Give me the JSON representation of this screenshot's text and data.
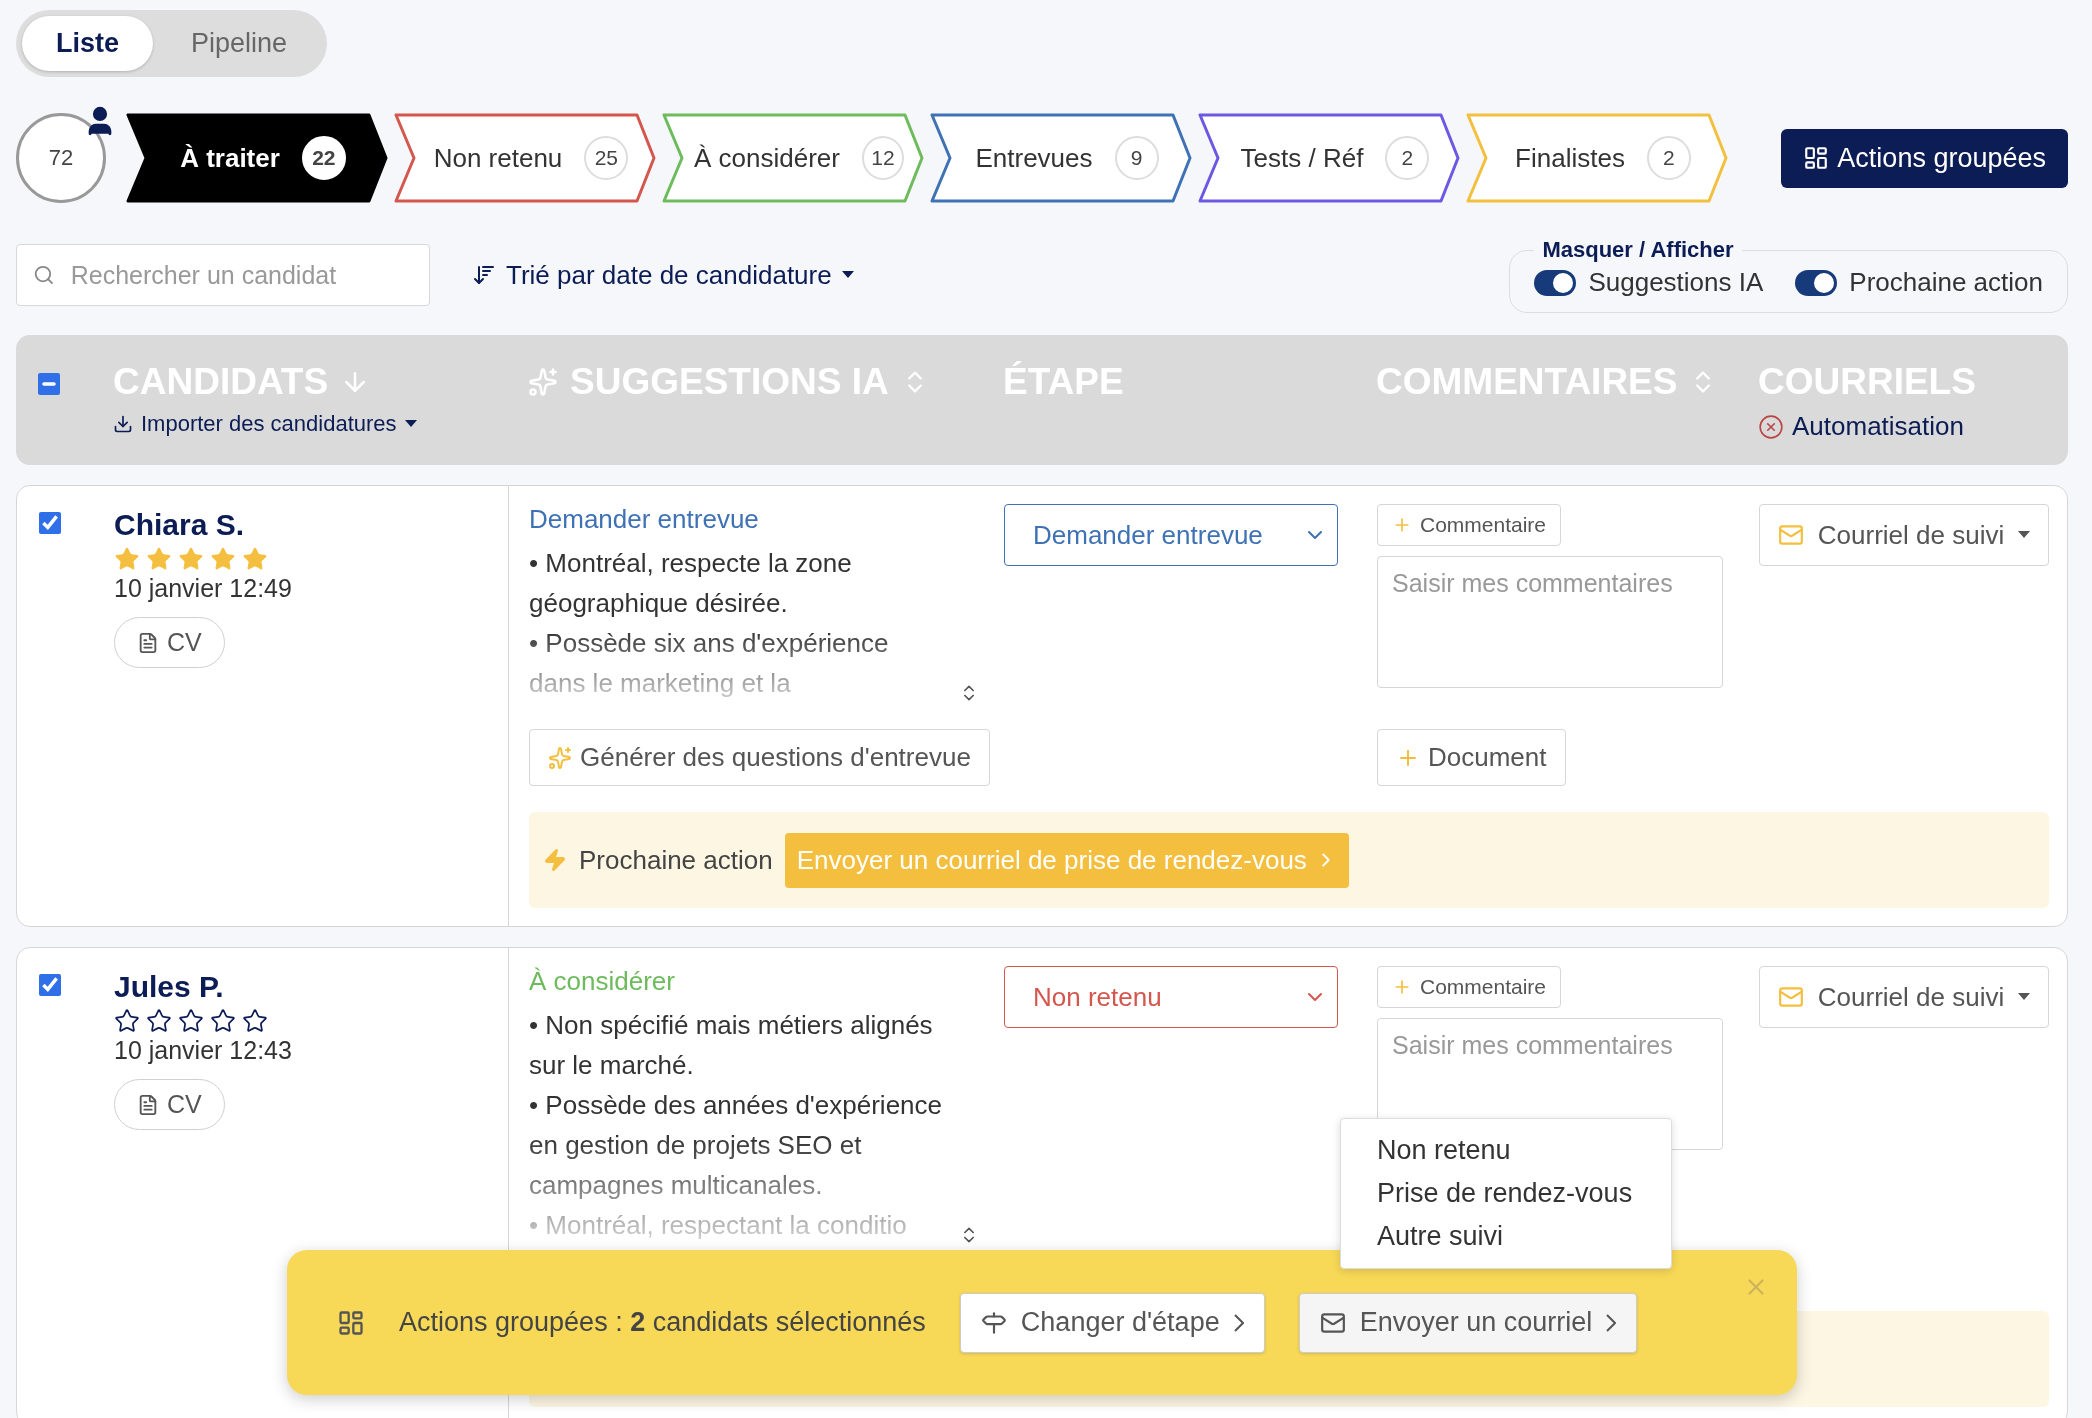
{
  "view_toggle": [
    {
      "label": "Liste",
      "selected": true
    },
    {
      "label": "Pipeline",
      "selected": false
    }
  ],
  "total": "72",
  "stages": [
    {
      "label": "À traiter",
      "count": "22",
      "color": "#000000",
      "selected": true
    },
    {
      "label": "Non retenu",
      "count": "25",
      "color": "#d4574e",
      "selected": false
    },
    {
      "label": "À considérer",
      "count": "12",
      "color": "#6dbb5c",
      "selected": false
    },
    {
      "label": "Entrevues",
      "count": "9",
      "color": "#3f72b5",
      "selected": false
    },
    {
      "label": "Tests / Réf",
      "count": "2",
      "color": "#6b58e3",
      "selected": false
    },
    {
      "label": "Finalistes",
      "count": "2",
      "color": "#f3bf3f",
      "selected": false
    }
  ],
  "bulk_button": "Actions groupées",
  "search": {
    "placeholder": "Rechercher un candidat"
  },
  "sort": "Trié par date de candidature",
  "visibility": {
    "legend": "Masquer / Afficher",
    "toggles": [
      {
        "label": "Suggestions IA",
        "on": true
      },
      {
        "label": "Prochaine action",
        "on": true
      }
    ]
  },
  "table": {
    "select_all_indeterminate": true,
    "columns": [
      {
        "kind": "candidates",
        "label": "CANDIDATS",
        "sorted": true,
        "sub": "Importer des candidatures"
      },
      {
        "kind": "ai",
        "label": "SUGGESTIONS IA",
        "sortable": true
      },
      {
        "kind": "stage",
        "label": "ÉTAPE"
      },
      {
        "kind": "comments",
        "label": "COMMENTAIRES",
        "sortable": true
      },
      {
        "kind": "emails",
        "label": "COURRIELS",
        "sub": "Automatisation",
        "automation_on": false
      }
    ],
    "rows": [
      {
        "name": "Chiara S.",
        "checked": true,
        "stars": 5,
        "date": "10 janvier 12:49",
        "cv": "CV",
        "suggestion": {
          "label": "Demander entrevue",
          "color": "#3f72b5",
          "bullets": [
            "• Montréal, respecte la zone géographique désirée.",
            "• Possède six ans d'expérience dans le marketing et la"
          ]
        },
        "stage": {
          "value": "Demander entrevue",
          "color": "#3f72b5"
        },
        "comment_button": "Commentaire",
        "comment_placeholder": "Saisir mes commentaires",
        "email_button": "Courriel de suivi",
        "generate_button": "Générer des questions d'entrevue",
        "document_button": "Document",
        "next_action": {
          "label": "Prochaine action",
          "button": "Envoyer un courriel de prise de rendez-vous"
        }
      },
      {
        "name": "Jules P.",
        "checked": true,
        "stars": 0,
        "date": "10 janvier 12:43",
        "cv": "CV",
        "suggestion": {
          "label": "À considérer",
          "color": "#6dbb5c",
          "bullets": [
            "• Non spécifié mais métiers alignés sur le marché.",
            "• Possède des années d'expérience en gestion de projets SEO et campagnes multicanales.",
            "• Montréal, respectant la conditio"
          ]
        },
        "stage": {
          "value": "Non retenu",
          "color": "#d4574e"
        },
        "comment_button": "Commentaire",
        "comment_placeholder": "Saisir mes commentaires",
        "email_button": "Courriel de suivi",
        "has_next_action": true
      }
    ]
  },
  "bulk_bar": {
    "text": "Actions groupées : **2** candidats sélectionnés",
    "stage_button": "Changer d'étape",
    "email_button": "Envoyer un courriel"
  },
  "email_menu": [
    {
      "label": "Non retenu",
      "selected": false
    },
    {
      "label": "Prise de rendez-vous",
      "selected": false
    },
    {
      "label": "Autre suivi",
      "selected": false
    }
  ]
}
